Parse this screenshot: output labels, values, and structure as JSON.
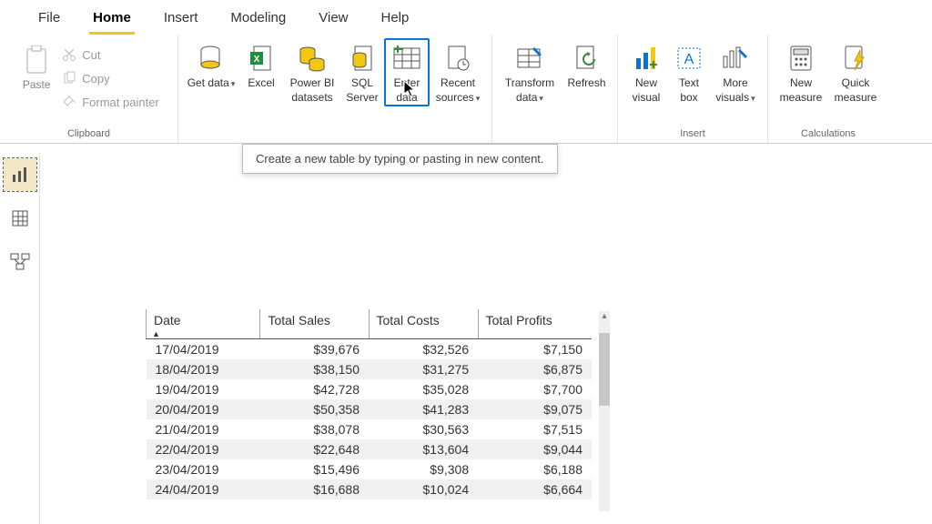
{
  "menu_tabs": [
    "File",
    "Home",
    "Insert",
    "Modeling",
    "View",
    "Help"
  ],
  "active_tab": "Home",
  "ribbon": {
    "clipboard": {
      "paste": "Paste",
      "cut": "Cut",
      "copy": "Copy",
      "format_painter": "Format painter",
      "group_label": "Clipboard"
    },
    "data": {
      "get_data": "Get data",
      "excel": "Excel",
      "pbi_datasets": "Power BI datasets",
      "sql": "SQL Server",
      "enter_data": "Enter data",
      "recent": "Recent sources"
    },
    "queries": {
      "transform": "Transform data",
      "refresh": "Refresh"
    },
    "insert": {
      "new_visual": "New visual",
      "text_box": "Text box",
      "more_visuals": "More visuals",
      "group_label": "Insert"
    },
    "calc": {
      "new_measure": "New measure",
      "quick_measure": "Quick measure",
      "group_label": "Calculations"
    }
  },
  "tooltip": "Create a new table by typing or pasting in new content.",
  "table": {
    "headers": [
      "Date",
      "Total Sales",
      "Total Costs",
      "Total Profits"
    ],
    "rows": [
      [
        "17/04/2019",
        "$39,676",
        "$32,526",
        "$7,150"
      ],
      [
        "18/04/2019",
        "$38,150",
        "$31,275",
        "$6,875"
      ],
      [
        "19/04/2019",
        "$42,728",
        "$35,028",
        "$7,700"
      ],
      [
        "20/04/2019",
        "$50,358",
        "$41,283",
        "$9,075"
      ],
      [
        "21/04/2019",
        "$38,078",
        "$30,563",
        "$7,515"
      ],
      [
        "22/04/2019",
        "$22,648",
        "$13,604",
        "$9,044"
      ],
      [
        "23/04/2019",
        "$15,496",
        "$9,308",
        "$6,188"
      ],
      [
        "24/04/2019",
        "$16,688",
        "$10,024",
        "$6,664"
      ]
    ]
  }
}
